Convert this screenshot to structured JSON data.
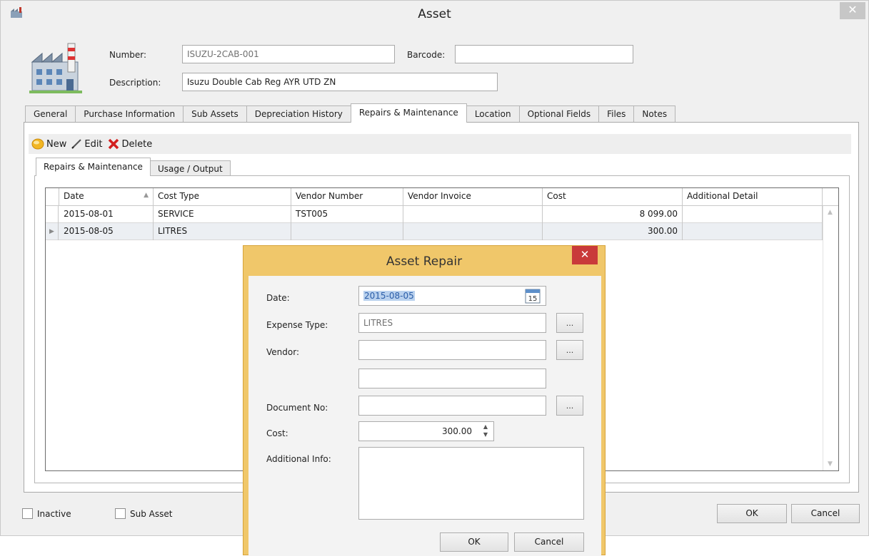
{
  "window": {
    "title": "Asset",
    "close": "✕"
  },
  "header": {
    "number_label": "Number:",
    "number_value": "ISUZU-2CAB-001",
    "barcode_label": "Barcode:",
    "barcode_value": "",
    "description_label": "Description:",
    "description_value": "Isuzu Double Cab Reg AYR UTD ZN"
  },
  "tabs": [
    {
      "label": "General"
    },
    {
      "label": "Purchase Information"
    },
    {
      "label": "Sub Assets"
    },
    {
      "label": "Depreciation History"
    },
    {
      "label": "Repairs & Maintenance"
    },
    {
      "label": "Location"
    },
    {
      "label": "Optional Fields"
    },
    {
      "label": "Files"
    },
    {
      "label": "Notes"
    }
  ],
  "toolbar": {
    "new": "New",
    "edit": "Edit",
    "delete": "Delete"
  },
  "subtabs": [
    {
      "label": "Repairs & Maintenance"
    },
    {
      "label": "Usage / Output"
    }
  ],
  "grid": {
    "columns": [
      "Date",
      "Cost Type",
      "Vendor Number",
      "Vendor Invoice",
      "Cost",
      "Additional Detail"
    ],
    "rows": [
      {
        "date": "2015-08-01",
        "cost_type": "SERVICE",
        "vendor_number": "TST005",
        "vendor_invoice": "",
        "cost": "8 099.00",
        "detail": ""
      },
      {
        "date": "2015-08-05",
        "cost_type": "LITRES",
        "vendor_number": "",
        "vendor_invoice": "",
        "cost": "300.00",
        "detail": ""
      }
    ]
  },
  "footer": {
    "inactive": "Inactive",
    "sub_asset": "Sub Asset",
    "ok": "OK",
    "cancel": "Cancel"
  },
  "dialog": {
    "title": "Asset Repair",
    "close": "✕",
    "date_label": "Date:",
    "date_value": "2015-08-05",
    "calendar_day": "15",
    "expense_label": "Expense Type:",
    "expense_value": "LITRES",
    "vendor_label": "Vendor:",
    "vendor_value": "",
    "vendor_name": "",
    "document_label": "Document No:",
    "document_value": "",
    "cost_label": "Cost:",
    "cost_value": "300.00",
    "info_label": "Additional Info:",
    "info_value": "",
    "browse": "...",
    "ok": "OK",
    "cancel": "Cancel"
  }
}
